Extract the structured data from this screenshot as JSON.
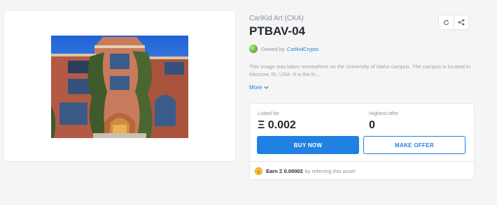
{
  "collection": {
    "name": "CarlKid Art (CKA)"
  },
  "asset": {
    "title": "PTBAV-04",
    "image_alt": "Historic brick university building with ivy-covered walls and arched entrance"
  },
  "actions": {
    "refresh_icon": "refresh-icon",
    "share_icon": "share-icon"
  },
  "owner": {
    "prefix": "Owned by",
    "name": "CarlkidCrypto"
  },
  "description": {
    "text": "This image was taken somewhere on the University of Idaho campus. The campus is located in Moscow, ID, USA. It is the fo...",
    "more_label": "More"
  },
  "listing": {
    "listed_label": "Listed for",
    "listed_price": "Ξ 0.002",
    "offer_label": "Highest offer",
    "offer_value": "0",
    "buy_label": "BUY NOW",
    "make_offer_label": "MAKE OFFER"
  },
  "referral": {
    "earn_text": "Earn Ξ 0.00002",
    "suffix": "by referring this asset"
  },
  "colors": {
    "accent": "#2081e2",
    "coin": "#f6c343"
  }
}
